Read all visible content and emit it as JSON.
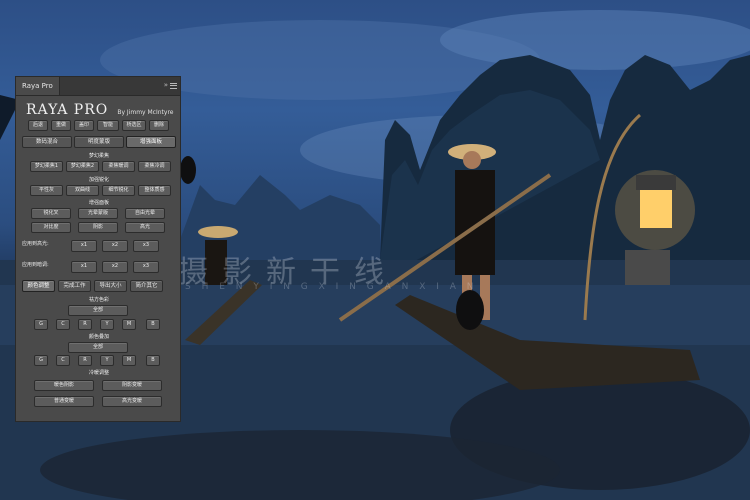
{
  "panel": {
    "tab_label": "Raya Pro",
    "collapse_glyph": "»",
    "title": "RAYA PRO",
    "by_line": "By Jimmy McIntyre",
    "toolbar": [
      "后退",
      "重做",
      "盖印",
      "智能",
      "桥选区",
      "删除"
    ],
    "main_tabs": [
      "数码混合",
      "明度蒙版",
      "增强面板"
    ],
    "active_main_tab": 2,
    "dream_title": "梦幻柔焦",
    "dream_buttons": [
      "梦幻柔焦1",
      "梦幻柔焦2",
      "柔焦暖调",
      "柔焦冷调"
    ],
    "sharpen_title": "加强锐化",
    "sharpen_buttons": [
      "平性灰",
      "双曲线",
      "细节锐化",
      "整体质感"
    ],
    "enhance_title": "增强面板",
    "enhance_row1": [
      "锐化叉",
      "光晕蒙版",
      "自由光晕"
    ],
    "enhance_row2": [
      "对比度",
      "阴影",
      "高光"
    ],
    "apply_highlight_label": "应用到高光:",
    "apply_highlight_buttons": [
      "x1",
      "x2",
      "x3"
    ],
    "apply_shadow_label": "应用到暗调:",
    "apply_shadow_buttons": [
      "x1",
      "x2",
      "x3"
    ],
    "bottom_tabs": [
      "颜色调整",
      "完成工作",
      "导出大小",
      "简介其它"
    ],
    "active_bottom_tab": 0,
    "color_removal_title": "祛方色彩",
    "color_removal_all": "全部",
    "color_removal_letters": [
      "G",
      "C",
      "R",
      "Y",
      "M",
      "B"
    ],
    "color_overlay_title": "颜色叠加",
    "color_overlay_all": "全部",
    "color_overlay_letters": [
      "G",
      "C",
      "R",
      "Y",
      "M",
      "B"
    ],
    "warm_cool_title": "冷暖调整",
    "warm_cool_row1": [
      "暖色阴影",
      "阴影变暖"
    ],
    "warm_cool_row2": [
      "普通变暖",
      "高光变暖"
    ]
  },
  "watermark": {
    "text": "摄影新干线",
    "sub": "S H E N Y I N G X I N G A N X I A N"
  },
  "colors": {
    "panel_bg": "#4a4a4a",
    "button_bg": "#5c5c5c",
    "text": "#eaeaea"
  }
}
